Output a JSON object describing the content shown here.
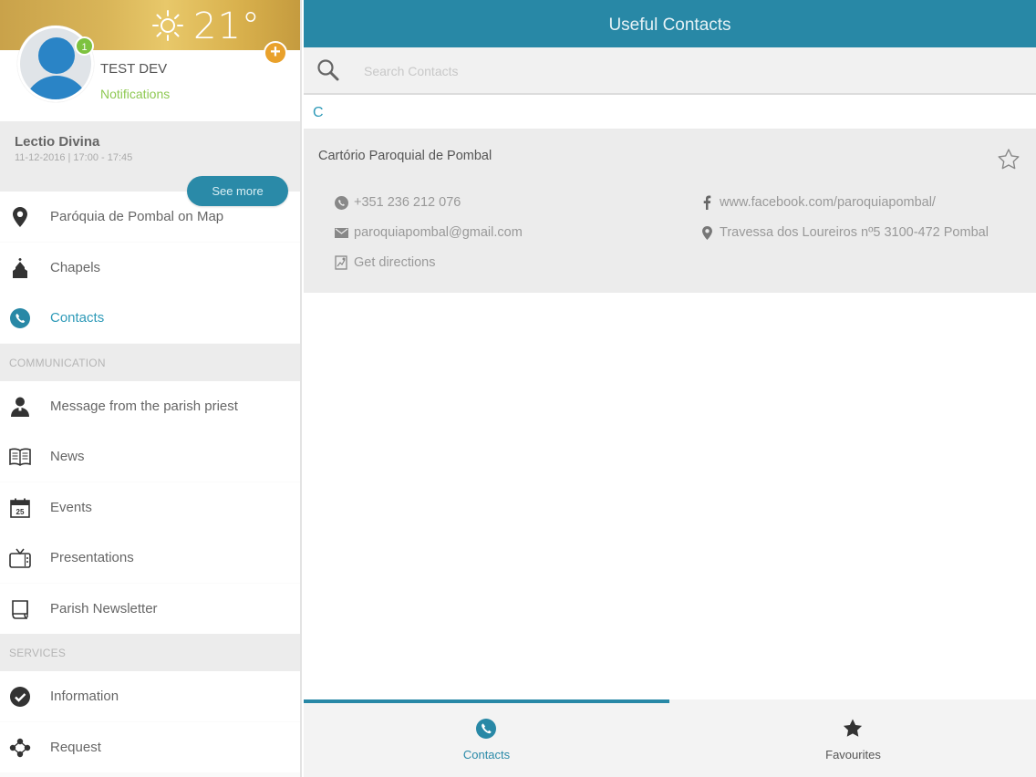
{
  "sidebar": {
    "weather": {
      "temperature": "21°",
      "icon": "sun-icon"
    },
    "add_button_label": "+",
    "profile": {
      "name": "TEST DEV",
      "notification_count": "1",
      "notifications_label": "Notifications"
    },
    "event": {
      "title": "Lectio Divina",
      "time": "11-12-2016 | 17:00 - 17:45",
      "see_more_label": "See more"
    },
    "items_top": [
      {
        "label": "Paróquia de Pombal on Map",
        "icon": "map-pin-icon"
      },
      {
        "label": "Chapels",
        "icon": "church-icon"
      },
      {
        "label": "Contacts",
        "icon": "phone-icon",
        "active": true
      }
    ],
    "sections": {
      "communication": "COMMUNICATION",
      "services": "SERVICES"
    },
    "items_communication": [
      {
        "label": "Message from the parish priest",
        "icon": "priest-icon"
      },
      {
        "label": "News",
        "icon": "newspaper-icon"
      },
      {
        "label": "Events",
        "icon": "calendar-icon"
      },
      {
        "label": "Presentations",
        "icon": "tv-icon"
      },
      {
        "label": "Parish Newsletter",
        "icon": "newsletter-icon"
      }
    ],
    "items_services": [
      {
        "label": "Information",
        "icon": "check-circle-icon"
      },
      {
        "label": "Request",
        "icon": "share-icon"
      }
    ]
  },
  "main": {
    "title": "Useful Contacts",
    "search": {
      "placeholder": "Search Contacts"
    },
    "group_letter": "C",
    "contact": {
      "name": "Cartório Paroquial de Pombal",
      "phone": "+351 236 212 076",
      "email": "paroquiapombal@gmail.com",
      "directions": "Get directions",
      "facebook": "www.facebook.com/paroquiapombal/",
      "address": "Travessa dos Loureiros nº5  3100-472 Pombal"
    },
    "tabs": [
      {
        "label": "Contacts",
        "icon": "phone-icon",
        "active": true
      },
      {
        "label": "Favourites",
        "icon": "star-icon"
      }
    ]
  },
  "colors": {
    "accent": "#2888a6",
    "active_text": "#2e9ab8",
    "notification_green": "#7dc23f",
    "add_orange": "#e9a12b"
  }
}
